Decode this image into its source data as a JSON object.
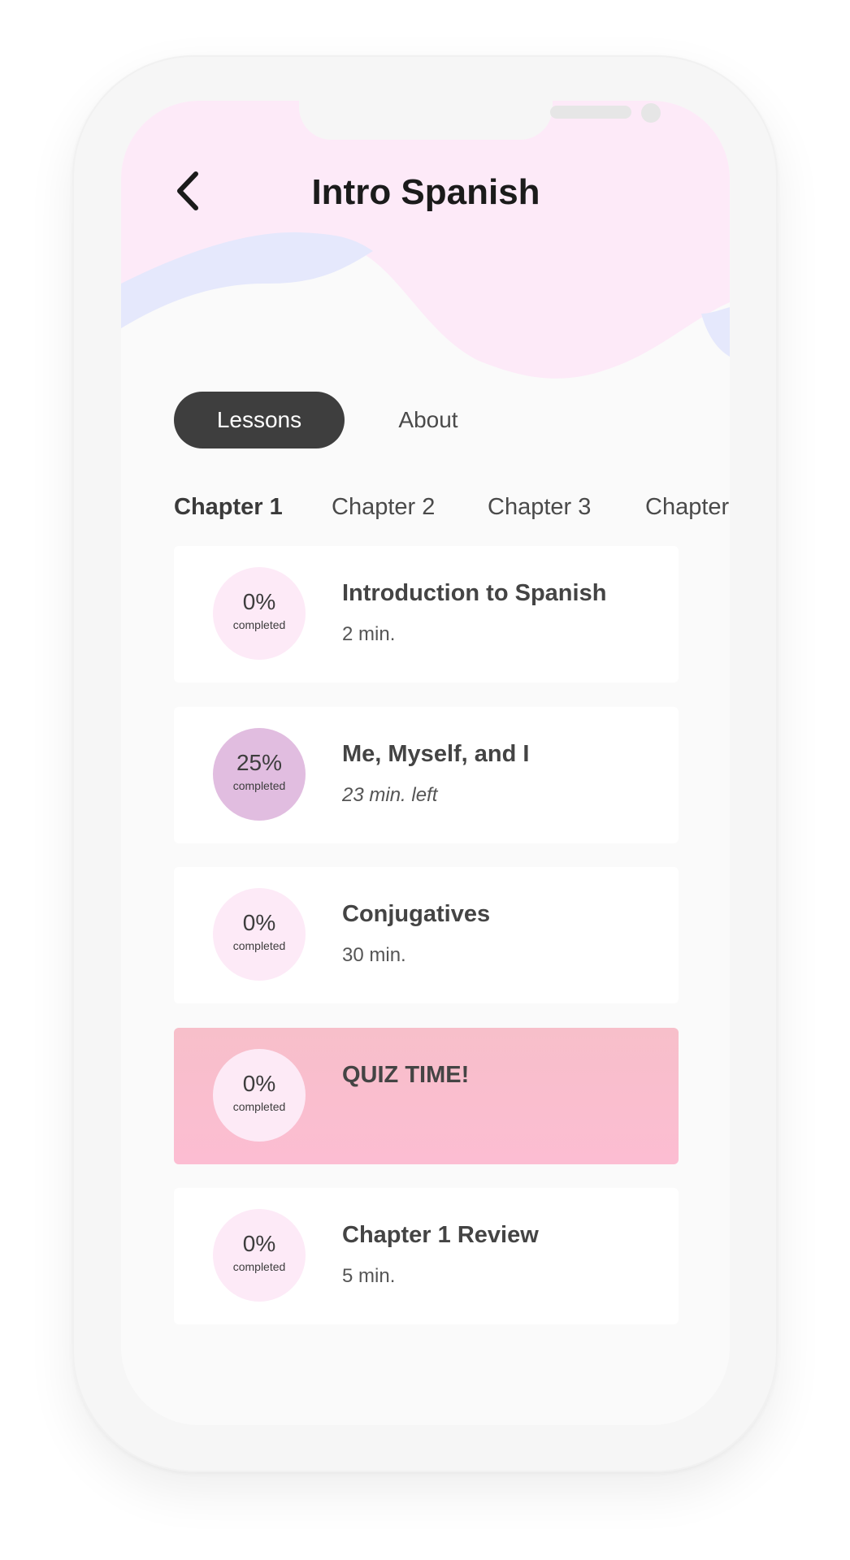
{
  "app": {
    "title": "Intro Spanish",
    "back_icon": "chevron-left-icon"
  },
  "segments": {
    "lessons": "Lessons",
    "about": "About",
    "selected": "Lessons"
  },
  "chapters": [
    {
      "label": "Chapter 1",
      "active": true
    },
    {
      "label": "Chapter 2",
      "active": false
    },
    {
      "label": "Chapter 3",
      "active": false
    },
    {
      "label": "Chapter",
      "active": false
    }
  ],
  "lessons": [
    {
      "percent": "0%",
      "status": "completed",
      "title": "Introduction to Spanish",
      "meta": "2 min."
    },
    {
      "percent": "25%",
      "status": "completed",
      "title": "Me, Myself, and I",
      "meta": "23 min. left"
    },
    {
      "percent": "0%",
      "status": "completed",
      "title": "Conjugatives",
      "meta": "30 min."
    },
    {
      "percent": "0%",
      "status": "completed",
      "title": "QUIZ TIME!",
      "meta": ""
    },
    {
      "percent": "0%",
      "status": "completed",
      "title": "Chapter 1 Review",
      "meta": "5 min."
    }
  ],
  "colors": {
    "header_pink": "#fdeaf8",
    "header_lavender": "#e5e8fc",
    "segment_active": "#3e3e3e",
    "progress_empty": "#fdeaf7",
    "progress_started": "#e1bde0",
    "quiz_card": "#fbbecf"
  }
}
